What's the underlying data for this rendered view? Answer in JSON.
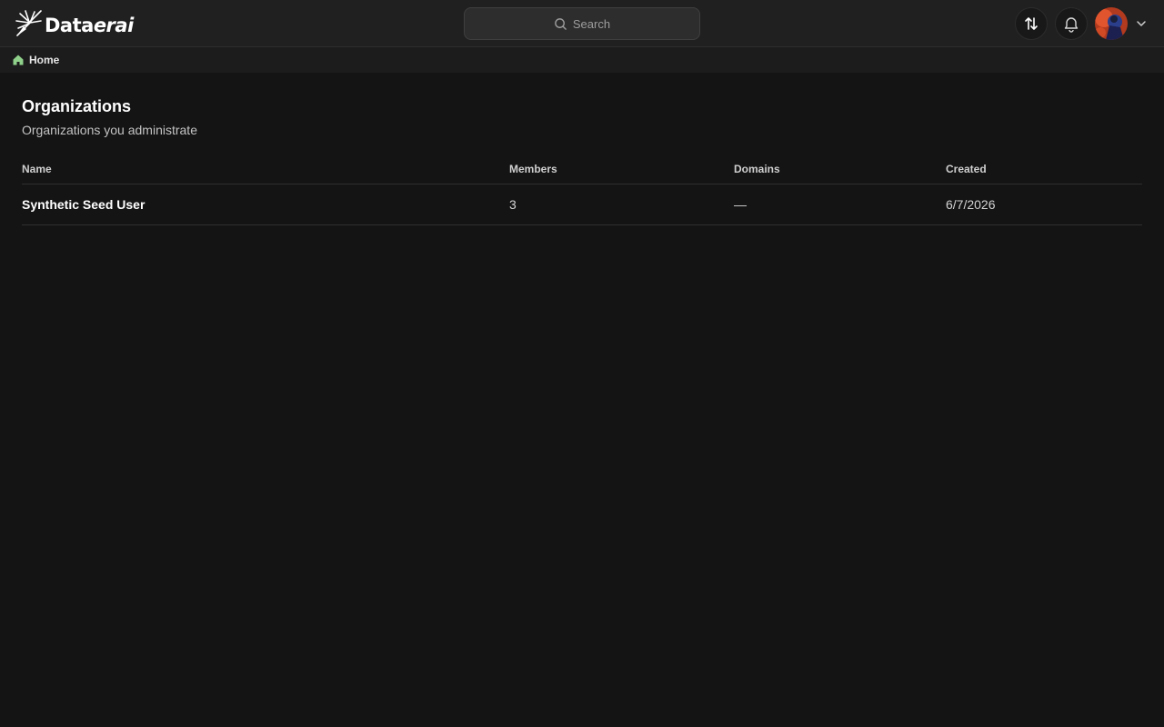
{
  "app": {
    "logo_text_plain": "Data",
    "logo_text_italic": "erai"
  },
  "header": {
    "search_label": "Search",
    "icons": [
      "search-icon",
      "sync-icon",
      "bell-icon",
      "chevron-down-icon"
    ]
  },
  "breadcrumb": {
    "home_label": "Home",
    "home_icon": "home-icon",
    "home_icon_color": "#8fd18a"
  },
  "page": {
    "title": "Organizations",
    "subtitle": "Organizations you administrate"
  },
  "table": {
    "headers": [
      "Name",
      "Members",
      "Domains",
      "Created"
    ],
    "rows": [
      {
        "name": "Synthetic Seed User",
        "members": "3",
        "domains": "—",
        "created": "6/7/2026"
      }
    ]
  },
  "colors": {
    "background": "#141414",
    "topbar": "#202020",
    "breadcrumb_bar": "#1c1c1c",
    "search_bg": "#2d2d2d"
  }
}
